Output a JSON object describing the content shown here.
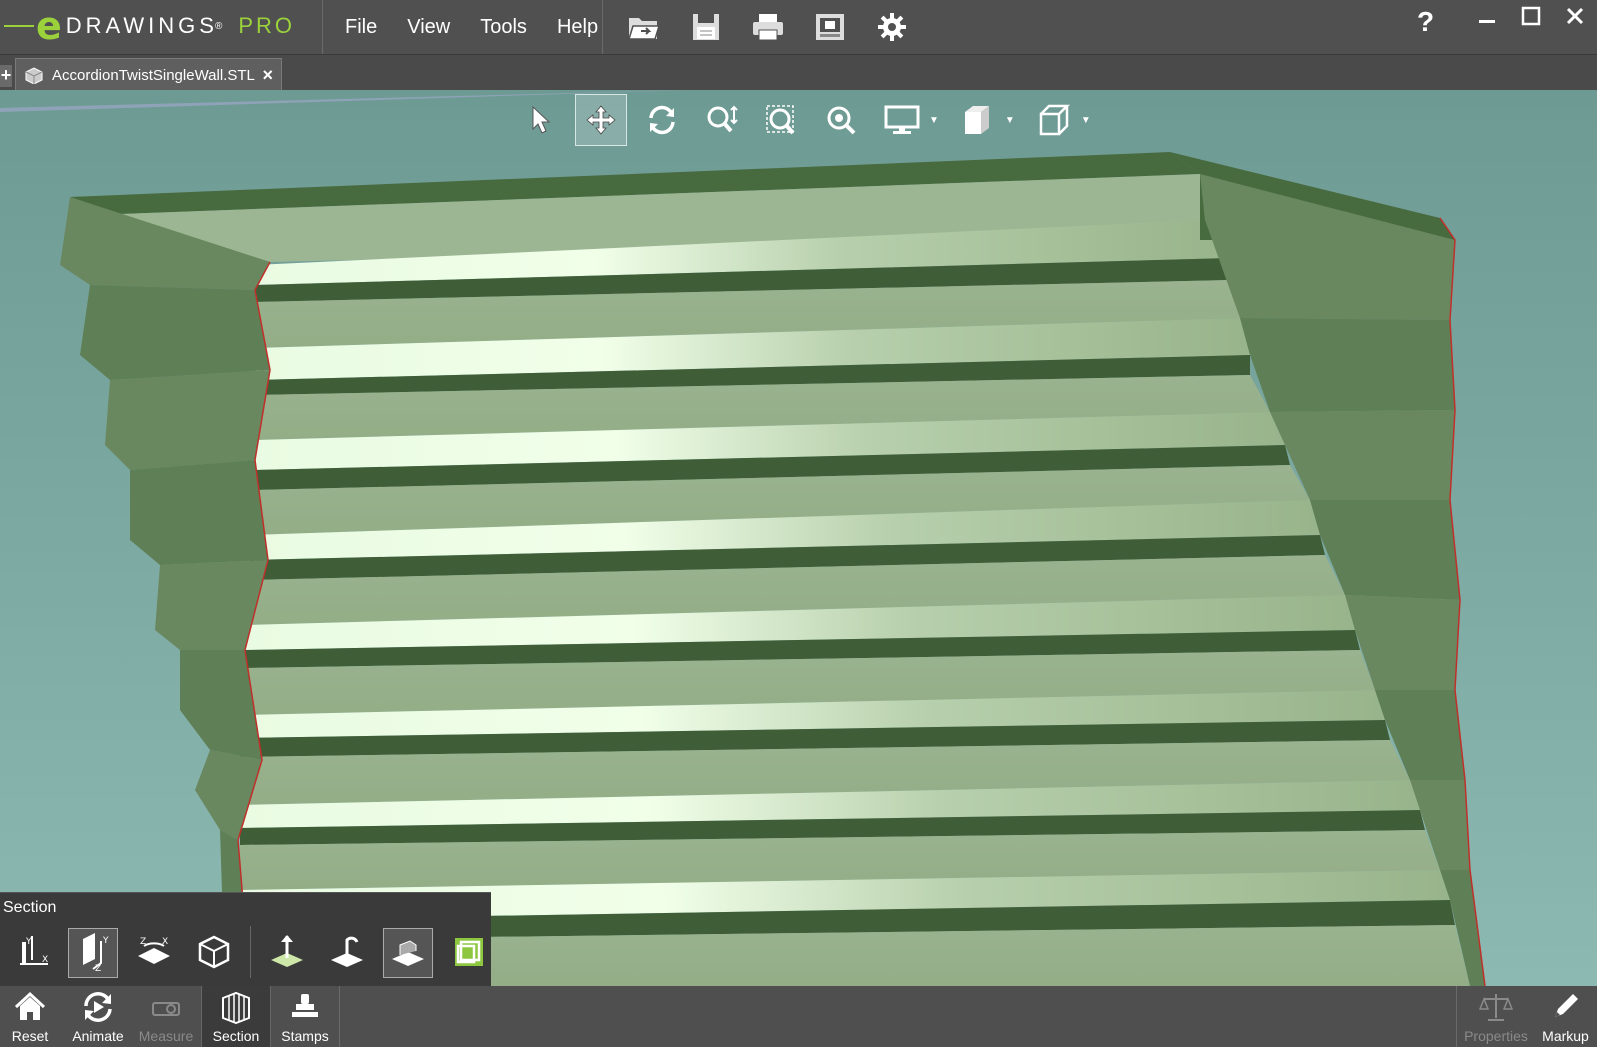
{
  "app": {
    "logo_letter": "e",
    "logo_name": "DRAWINGS",
    "logo_reg": "®",
    "logo_edition": "PRO",
    "brand_color": "#9bd23c"
  },
  "menu": [
    "File",
    "View",
    "Tools",
    "Help"
  ],
  "quick_access": [
    "open-icon",
    "save-icon",
    "print-icon",
    "page-setup-icon",
    "settings-gear-icon"
  ],
  "window_controls": {
    "help": "?",
    "minimize": "minimize-icon",
    "maximize": "maximize-icon",
    "close": "close-icon"
  },
  "tabs": {
    "new_tab_symbol": "+",
    "document": {
      "title": "AccordionTwistSingleWall.STL",
      "close": "×"
    }
  },
  "view_toolbar": [
    "select-icon",
    "pan-icon",
    "rotate-icon",
    "zoom-icon",
    "zoom-window-icon",
    "zoom-fit-icon",
    "display-style-icon",
    "views-icon",
    "orientation-cube-icon"
  ],
  "section_panel": {
    "title": "Section",
    "tools": [
      "section-xy-plane-icon",
      "section-yz-plane-icon",
      "section-zx-plane-icon",
      "section-box-icon",
      "flip-section-icon",
      "section-cap-icon",
      "show-section-plane-icon",
      "section-cap-color-icon"
    ]
  },
  "bottom_toolbar": {
    "left": [
      {
        "label": "Reset",
        "icon": "home-icon",
        "enabled": true
      },
      {
        "label": "Animate",
        "icon": "animate-icon",
        "enabled": true
      },
      {
        "label": "Measure",
        "icon": "measure-icon",
        "enabled": false
      },
      {
        "label": "Section",
        "icon": "section-icon",
        "enabled": true,
        "selected": true
      },
      {
        "label": "Stamps",
        "icon": "stamps-icon",
        "enabled": true
      }
    ],
    "right": [
      {
        "label": "Properties",
        "icon": "properties-scale-icon",
        "enabled": false
      },
      {
        "label": "Markup",
        "icon": "markup-pencil-icon",
        "enabled": true
      }
    ]
  },
  "model": {
    "name": "accordion twist single wall",
    "color": "#8aa880",
    "section_edge_color": "#c0302a"
  }
}
